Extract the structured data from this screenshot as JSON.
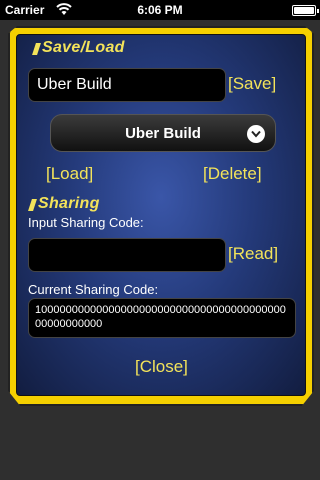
{
  "status_bar": {
    "carrier": "Carrier",
    "time": "6:06 PM",
    "battery_level": 1.0
  },
  "save_load": {
    "title": "Save/Load",
    "name_value": "Uber Build",
    "save_label": "[Save]",
    "selected_build": "Uber Build",
    "load_label": "[Load]",
    "delete_label": "[Delete]"
  },
  "sharing": {
    "title": "Sharing",
    "input_label": "Input Sharing Code:",
    "input_value": "",
    "read_label": "[Read]",
    "current_label": "Current Sharing Code:",
    "current_code": "1000000000000000000000000000000000000000000000000000"
  },
  "close_label": "[Close]",
  "colors": {
    "accent": "#f3e35a",
    "frame": "#f5d000",
    "panel": "#243a7a"
  },
  "icons": [
    "wifi-icon",
    "battery-icon",
    "chevron-down-icon"
  ]
}
